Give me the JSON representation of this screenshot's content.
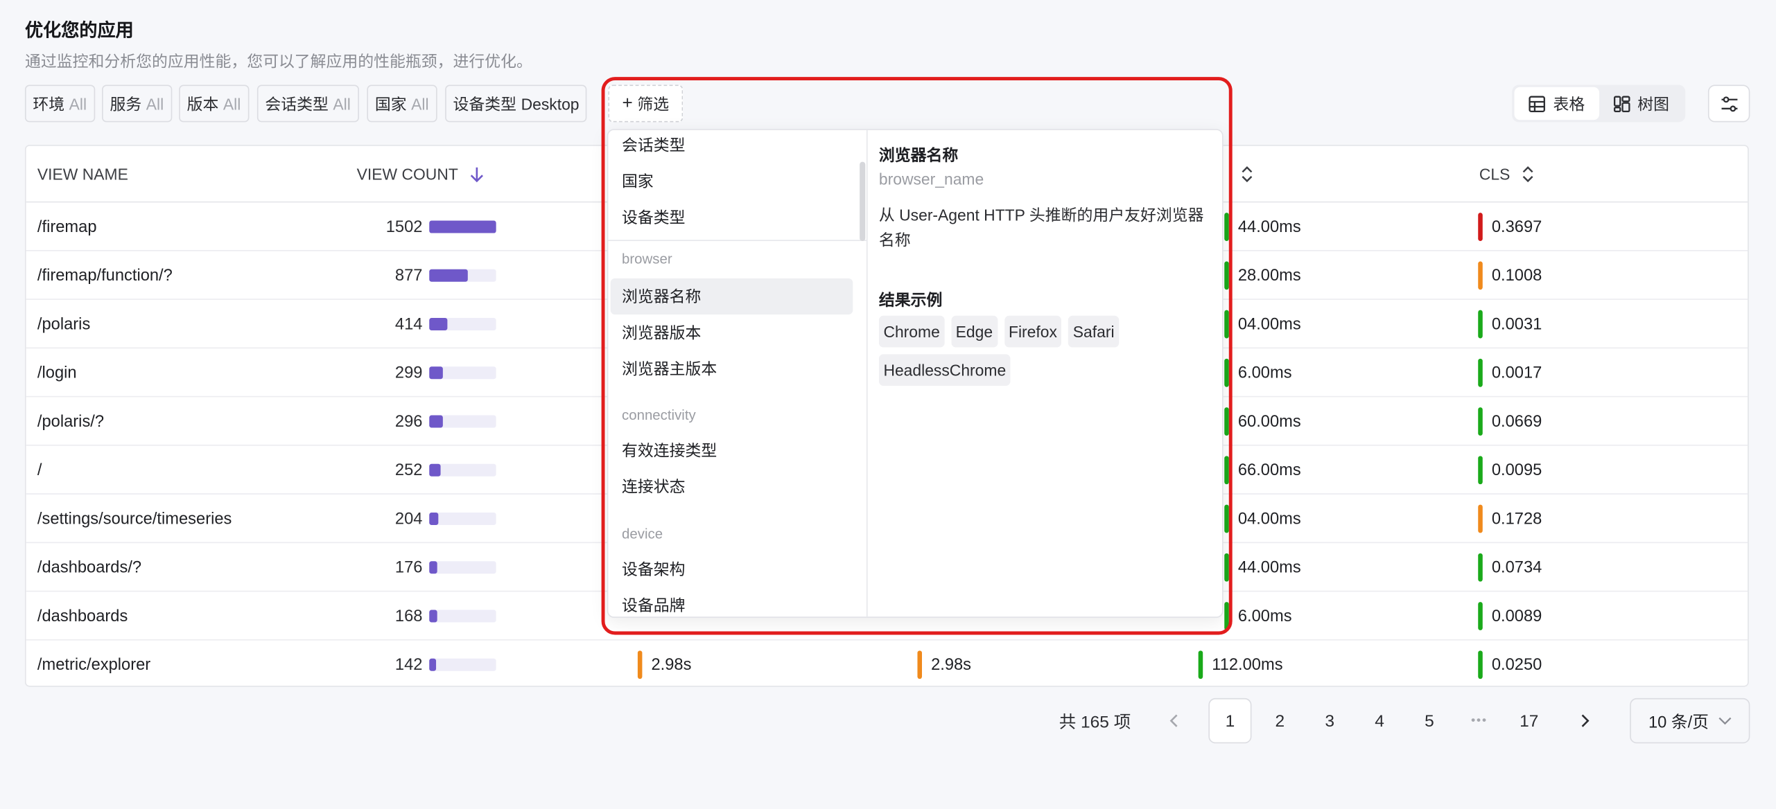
{
  "header": {
    "title": "优化您的应用",
    "subtitle": "通过监控和分析您的应用性能，您可以了解应用的性能瓶颈，进行优化。"
  },
  "filters": [
    {
      "key": "环境",
      "value": "All"
    },
    {
      "key": "服务",
      "value": "All"
    },
    {
      "key": "版本",
      "value": "All"
    },
    {
      "key": "会话类型",
      "value": "All"
    },
    {
      "key": "国家",
      "value": "All"
    },
    {
      "key": "设备类型",
      "value": "Desktop"
    }
  ],
  "add_filter_label": "筛选",
  "view_toggle": {
    "table": "表格",
    "tree": "树图"
  },
  "table": {
    "columns": {
      "view_name": "VIEW NAME",
      "view_count": "VIEW COUNT",
      "cls": "CLS"
    },
    "rows": [
      {
        "name": "/firemap",
        "count": "1502",
        "bar": 1.0,
        "ms": "44.00ms",
        "cls": "0.3697",
        "cls_color": "#d11a1a"
      },
      {
        "name": "/firemap/function/?",
        "count": "877",
        "bar": 0.584,
        "ms": "28.00ms",
        "cls": "0.1008",
        "cls_color": "#f08a1c"
      },
      {
        "name": "/polaris",
        "count": "414",
        "bar": 0.276,
        "ms": "04.00ms",
        "cls": "0.0031",
        "cls_color": "#1aaa1a"
      },
      {
        "name": "/login",
        "count": "299",
        "bar": 0.199,
        "ms": "6.00ms",
        "cls": "0.0017",
        "cls_color": "#1aaa1a"
      },
      {
        "name": "/polaris/?",
        "count": "296",
        "bar": 0.197,
        "ms": "60.00ms",
        "cls": "0.0669",
        "cls_color": "#1aaa1a"
      },
      {
        "name": "/",
        "count": "252",
        "bar": 0.168,
        "ms": "66.00ms",
        "cls": "0.0095",
        "cls_color": "#1aaa1a"
      },
      {
        "name": "/settings/source/timeseries",
        "count": "204",
        "bar": 0.136,
        "ms": "04.00ms",
        "cls": "0.1728",
        "cls_color": "#f08a1c"
      },
      {
        "name": "/dashboards/?",
        "count": "176",
        "bar": 0.117,
        "ms": "44.00ms",
        "cls": "0.0734",
        "cls_color": "#1aaa1a"
      },
      {
        "name": "/dashboards",
        "count": "168",
        "bar": 0.112,
        "ms": "6.00ms",
        "cls": "0.0089",
        "cls_color": "#1aaa1a"
      },
      {
        "name": "/metric/explorer",
        "count": "142",
        "bar": 0.095,
        "ms": "112.00ms",
        "cls": "0.0250",
        "cls_color": "#1aaa1a"
      }
    ],
    "last_row_extra": {
      "a": "2.98s",
      "b": "2.98s"
    }
  },
  "pagination": {
    "total": "共 165 项",
    "pages": [
      "1",
      "2",
      "3",
      "4",
      "5",
      "17"
    ],
    "ellipsis": "•••",
    "page_size": "10 条/页"
  },
  "popover": {
    "options_top": [
      "会话类型",
      "国家",
      "设备类型"
    ],
    "group_browser": "browser",
    "browser_options": [
      "浏览器名称",
      "浏览器版本",
      "浏览器主版本"
    ],
    "group_connectivity": "connectivity",
    "connectivity_options": [
      "有效连接类型",
      "连接状态"
    ],
    "group_device": "device",
    "device_options": [
      "设备架构",
      "设备品牌"
    ],
    "detail": {
      "title": "浏览器名称",
      "key": "browser_name",
      "description": "从 User-Agent HTTP 头推断的用户友好浏览器名称",
      "examples_title": "结果示例",
      "examples": [
        "Chrome",
        "Edge",
        "Firefox",
        "Safari",
        "HeadlessChrome"
      ]
    }
  },
  "colors": {
    "accent": "#6f58c9",
    "good": "#1aaa1a",
    "warn": "#f08a1c",
    "bad": "#d11a1a",
    "highlight": "#e21d1d"
  }
}
